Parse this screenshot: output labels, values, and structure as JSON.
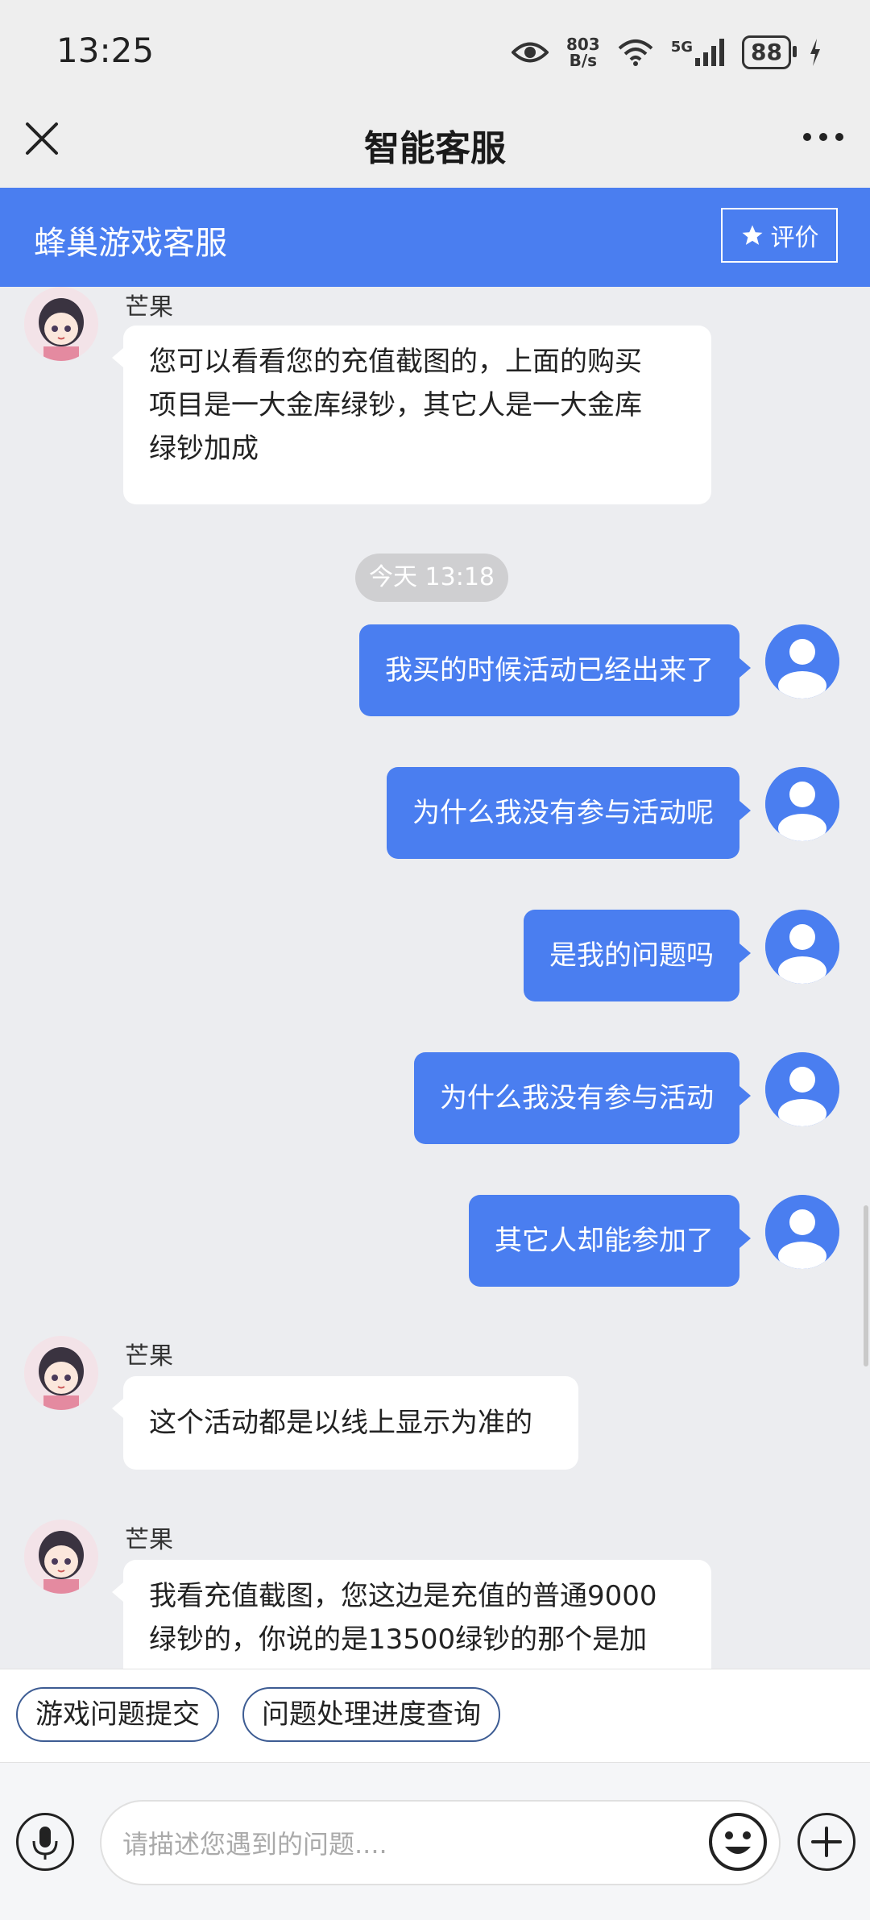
{
  "status_bar": {
    "time": "13:25",
    "net_speed_value": "803",
    "net_speed_unit": "B/s",
    "network": "5G",
    "battery": "88"
  },
  "nav": {
    "title": "智能客服"
  },
  "header": {
    "title": "蜂巢游戏客服",
    "rate_label": "评价"
  },
  "colors": {
    "accent": "#4a7ef0",
    "background": "#ecedf0"
  },
  "messages": [
    {
      "side": "left",
      "sender": "芒果",
      "lines": [
        "您可以看看您的充值截图的，上面的购买",
        "项目是一大金库绿钞，其它人是一大金库",
        "绿钞加成"
      ]
    },
    {
      "side": "time",
      "text": "今天 13:18"
    },
    {
      "side": "right",
      "text": "我买的时候活动已经出来了"
    },
    {
      "side": "right",
      "text": "为什么我没有参与活动呢"
    },
    {
      "side": "right",
      "text": "是我的问题吗"
    },
    {
      "side": "right",
      "text": "为什么我没有参与活动"
    },
    {
      "side": "right",
      "text": "其它人却能参加了"
    },
    {
      "side": "left",
      "sender": "芒果",
      "lines": [
        "这个活动都是以线上显示为准的"
      ]
    },
    {
      "side": "left",
      "sender": "芒果",
      "lines": [
        "我看充值截图，您这边是充值的普通9000",
        "绿钞的，你说的是13500绿钞的那个是加"
      ]
    }
  ],
  "quick_actions": [
    "游戏问题提交",
    "问题处理进度查询"
  ],
  "input": {
    "placeholder": "请描述您遇到的问题...."
  }
}
